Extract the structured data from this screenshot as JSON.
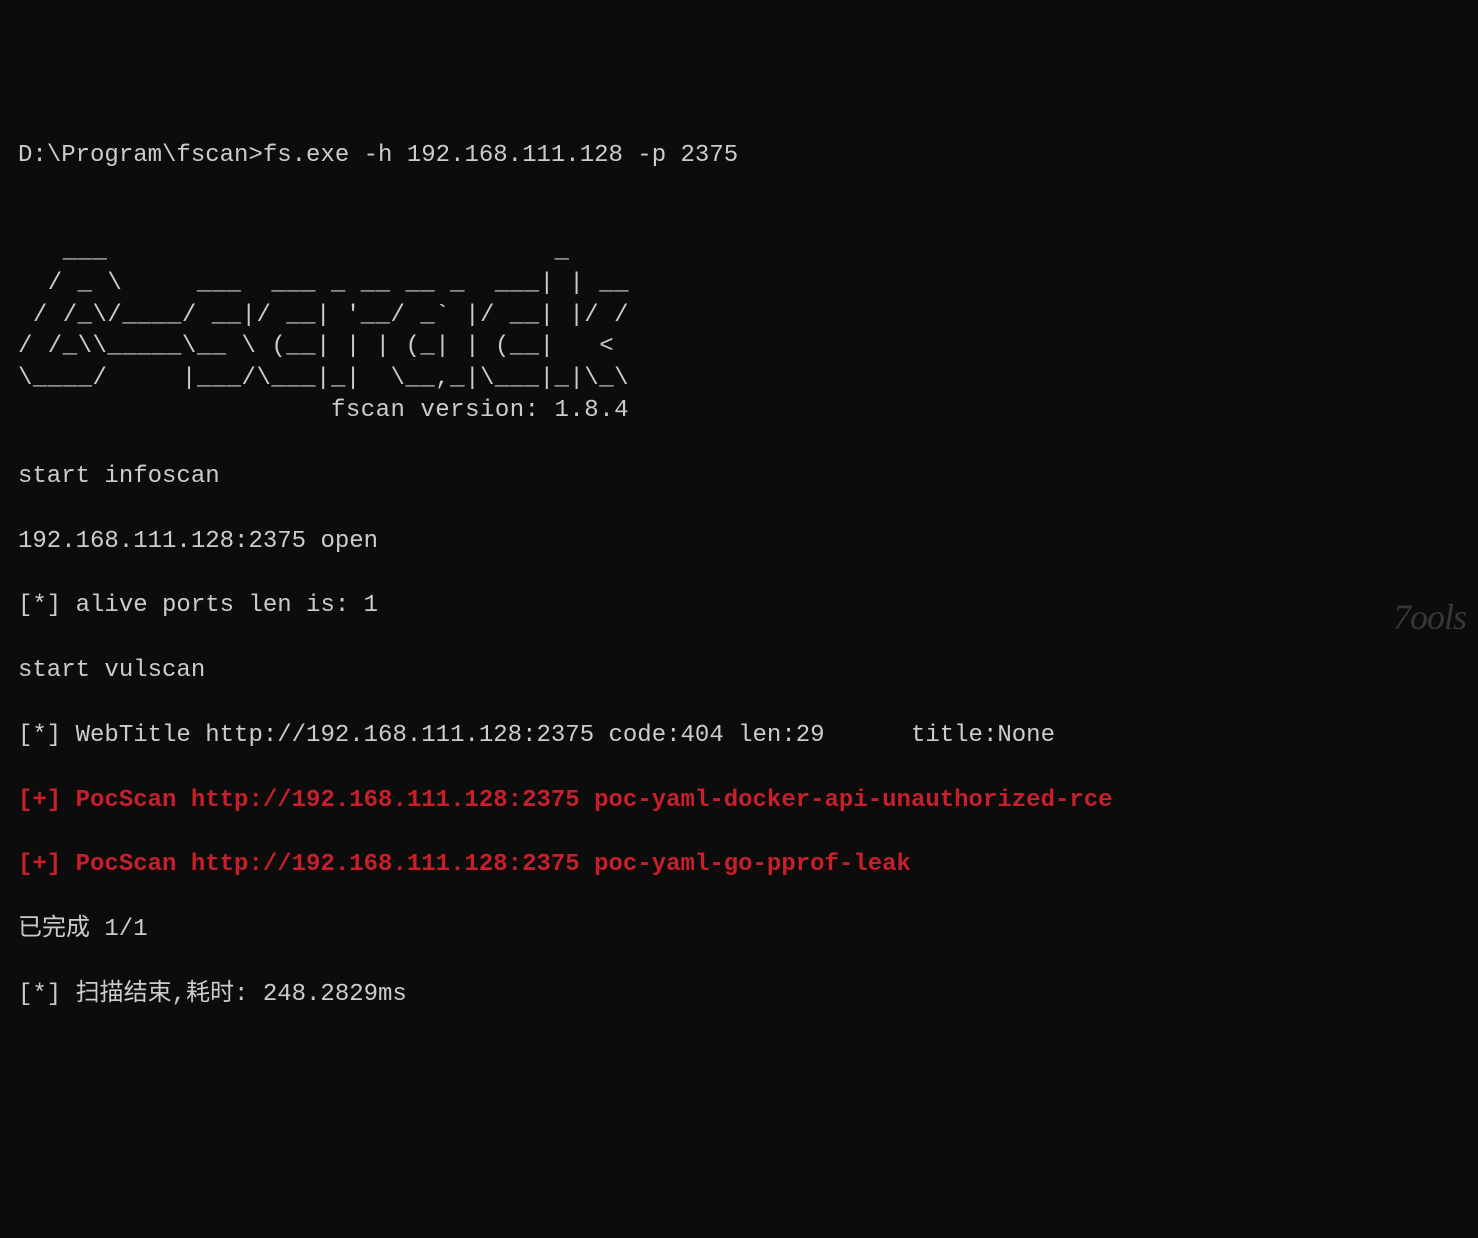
{
  "prompt": "D:\\Program\\fscan>fs.exe -h 192.168.111.128 -p 2375",
  "ascii_art": "   ___                              _\n  / _ \\     ___  ___ _ __ __ _  ___| | __\n / /_\\/____/ __|/ __| '__/ _` |/ __| |/ /\n/ /_\\\\_____\\__ \\ (__| | | (_| | (__|   <\n\\____/     |___/\\___|_|  \\__,_|\\___|_|\\_\\\n                     fscan version: 1.8.4",
  "lines": {
    "l1": "start infoscan",
    "l2": "192.168.111.128:2375 open",
    "l3": "[*] alive ports len is: 1",
    "l4": "start vulscan",
    "l5": "[*] WebTitle http://192.168.111.128:2375 code:404 len:29      title:None",
    "l6": "[+] PocScan http://192.168.111.128:2375 poc-yaml-docker-api-unauthorized-rce",
    "l7": "[+] PocScan http://192.168.111.128:2375 poc-yaml-go-pprof-leak",
    "l8": "已完成 1/1",
    "l9": "[*] 扫描结束,耗时: 248.2829ms"
  },
  "watermark": "7ools"
}
